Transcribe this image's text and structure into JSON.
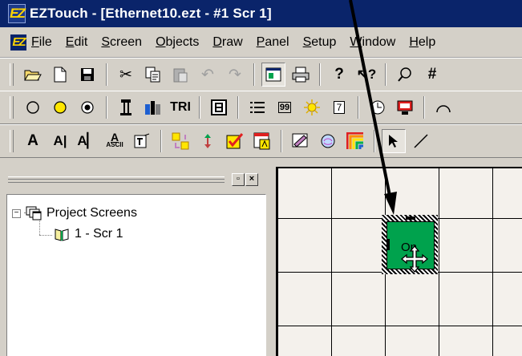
{
  "window": {
    "title": "EZTouch - [Ethernet10.ezt - #1 Scr 1]"
  },
  "menu": {
    "items": [
      {
        "key": "F",
        "rest": "ile"
      },
      {
        "key": "E",
        "rest": "dit"
      },
      {
        "key": "S",
        "rest": "creen"
      },
      {
        "key": "O",
        "rest": "bjects"
      },
      {
        "key": "D",
        "rest": "raw"
      },
      {
        "key": "P",
        "rest": "anel"
      },
      {
        "key": "S",
        "rest": "etup",
        "split": true
      },
      {
        "key": "W",
        "rest": "indow"
      },
      {
        "key": "H",
        "rest": "elp"
      }
    ]
  },
  "toolbar2": {
    "tri_label": "TRI",
    "seven_label": "7",
    "nine_label": "99"
  },
  "toolbar3": {
    "ascii_label": "ASCII"
  },
  "tree": {
    "root": {
      "expander": "−",
      "label": "Project Screens"
    },
    "child": {
      "label": "1 - Scr 1"
    }
  },
  "canvas": {
    "object_label": "On",
    "object_color": "#00a24d",
    "grid_background": "#f4f1ec"
  },
  "colors": {
    "titlebar": "#0a246a",
    "chrome": "#d4d0c8"
  }
}
